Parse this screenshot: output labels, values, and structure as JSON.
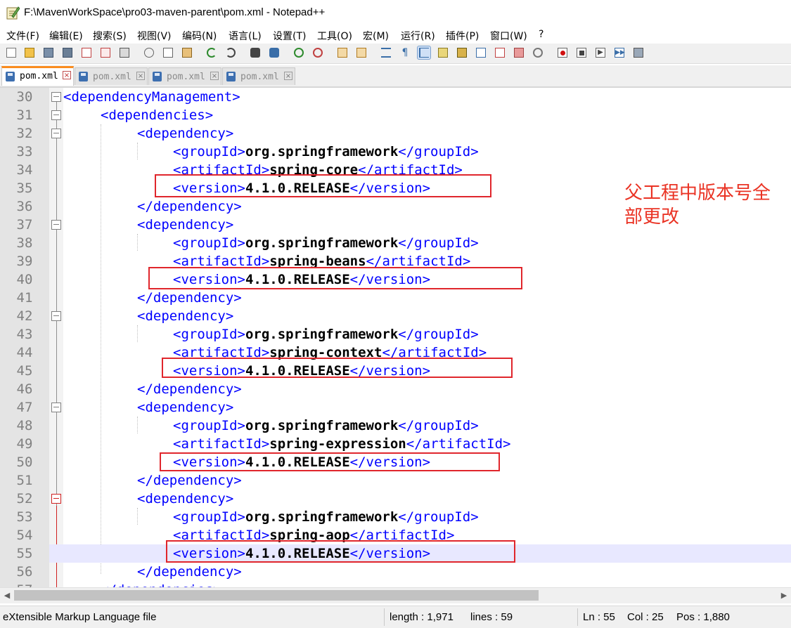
{
  "window": {
    "title": "F:\\MavenWorkSpace\\pro03-maven-parent\\pom.xml - Notepad++"
  },
  "menu": [
    "文件(F)",
    "编辑(E)",
    "搜索(S)",
    "视图(V)",
    "编码(N)",
    "语言(L)",
    "设置(T)",
    "工具(O)",
    "宏(M)",
    "运行(R)",
    "插件(P)",
    "窗口(W)",
    "?"
  ],
  "tabs": [
    {
      "label": "pom.xml",
      "active": true
    },
    {
      "label": "pom.xml",
      "active": false
    },
    {
      "label": "pom.xml",
      "active": false
    },
    {
      "label": "pom.xml",
      "active": false
    }
  ],
  "editor": {
    "current_line": 55,
    "lines": [
      {
        "num": "30",
        "text": "<dependencyManagement>"
      },
      {
        "num": "31",
        "text": "<dependencies>"
      },
      {
        "num": "32",
        "text": "<dependency>"
      },
      {
        "num": "33",
        "open": "<groupId>",
        "value": "org.springframework",
        "close": "</groupId>"
      },
      {
        "num": "34",
        "open": "<artifactId>",
        "value": "spring-core",
        "close": "</artifactId>"
      },
      {
        "num": "35",
        "open": "<version>",
        "value": "4.1.0.RELEASE",
        "close": "</version>"
      },
      {
        "num": "36",
        "text": "</dependency>"
      },
      {
        "num": "37",
        "text": "<dependency>"
      },
      {
        "num": "38",
        "open": "<groupId>",
        "value": "org.springframework",
        "close": "</groupId>"
      },
      {
        "num": "39",
        "open": "<artifactId>",
        "value": "spring-beans",
        "close": "</artifactId>"
      },
      {
        "num": "40",
        "open": "<version>",
        "value": "4.1.0.RELEASE",
        "close": "</version>"
      },
      {
        "num": "41",
        "text": "</dependency>"
      },
      {
        "num": "42",
        "text": "<dependency>"
      },
      {
        "num": "43",
        "open": "<groupId>",
        "value": "org.springframework",
        "close": "</groupId>"
      },
      {
        "num": "44",
        "open": "<artifactId>",
        "value": "spring-context",
        "close": "</artifactId>"
      },
      {
        "num": "45",
        "open": "<version>",
        "value": "4.1.0.RELEASE",
        "close": "</version>"
      },
      {
        "num": "46",
        "text": "</dependency>"
      },
      {
        "num": "47",
        "text": "<dependency>"
      },
      {
        "num": "48",
        "open": "<groupId>",
        "value": "org.springframework",
        "close": "</groupId>"
      },
      {
        "num": "49",
        "open": "<artifactId>",
        "value": "spring-expression",
        "close": "</artifactId>"
      },
      {
        "num": "50",
        "open": "<version>",
        "value": "4.1.0.RELEASE",
        "close": "</version>"
      },
      {
        "num": "51",
        "text": "</dependency>"
      },
      {
        "num": "52",
        "text": "<dependency>"
      },
      {
        "num": "53",
        "open": "<groupId>",
        "value": "org.springframework",
        "close": "</groupId>"
      },
      {
        "num": "54",
        "open": "<artifactId>",
        "value": "spring-aop",
        "close": "</artifactId>"
      },
      {
        "num": "55",
        "open": "<version>",
        "value": "4.1.0.RELEASE",
        "close": "</version>"
      },
      {
        "num": "56",
        "text": "</dependency>"
      },
      {
        "num": "57",
        "text": "</dependencies>"
      }
    ]
  },
  "annotation": {
    "line1": "父工程中版本号全",
    "line2": "部更改",
    "color": "#ea3324"
  },
  "status": {
    "filetype": "eXtensible Markup Language file",
    "length": "length : 1,971",
    "lines": "lines : 59",
    "ln": "Ln : 55",
    "col": "Col : 25",
    "pos": "Pos : 1,880"
  },
  "colors": {
    "tag": "#0000ff",
    "value": "#000000",
    "highlight_box": "#e0262c",
    "current_line": "#e8e8ff"
  }
}
